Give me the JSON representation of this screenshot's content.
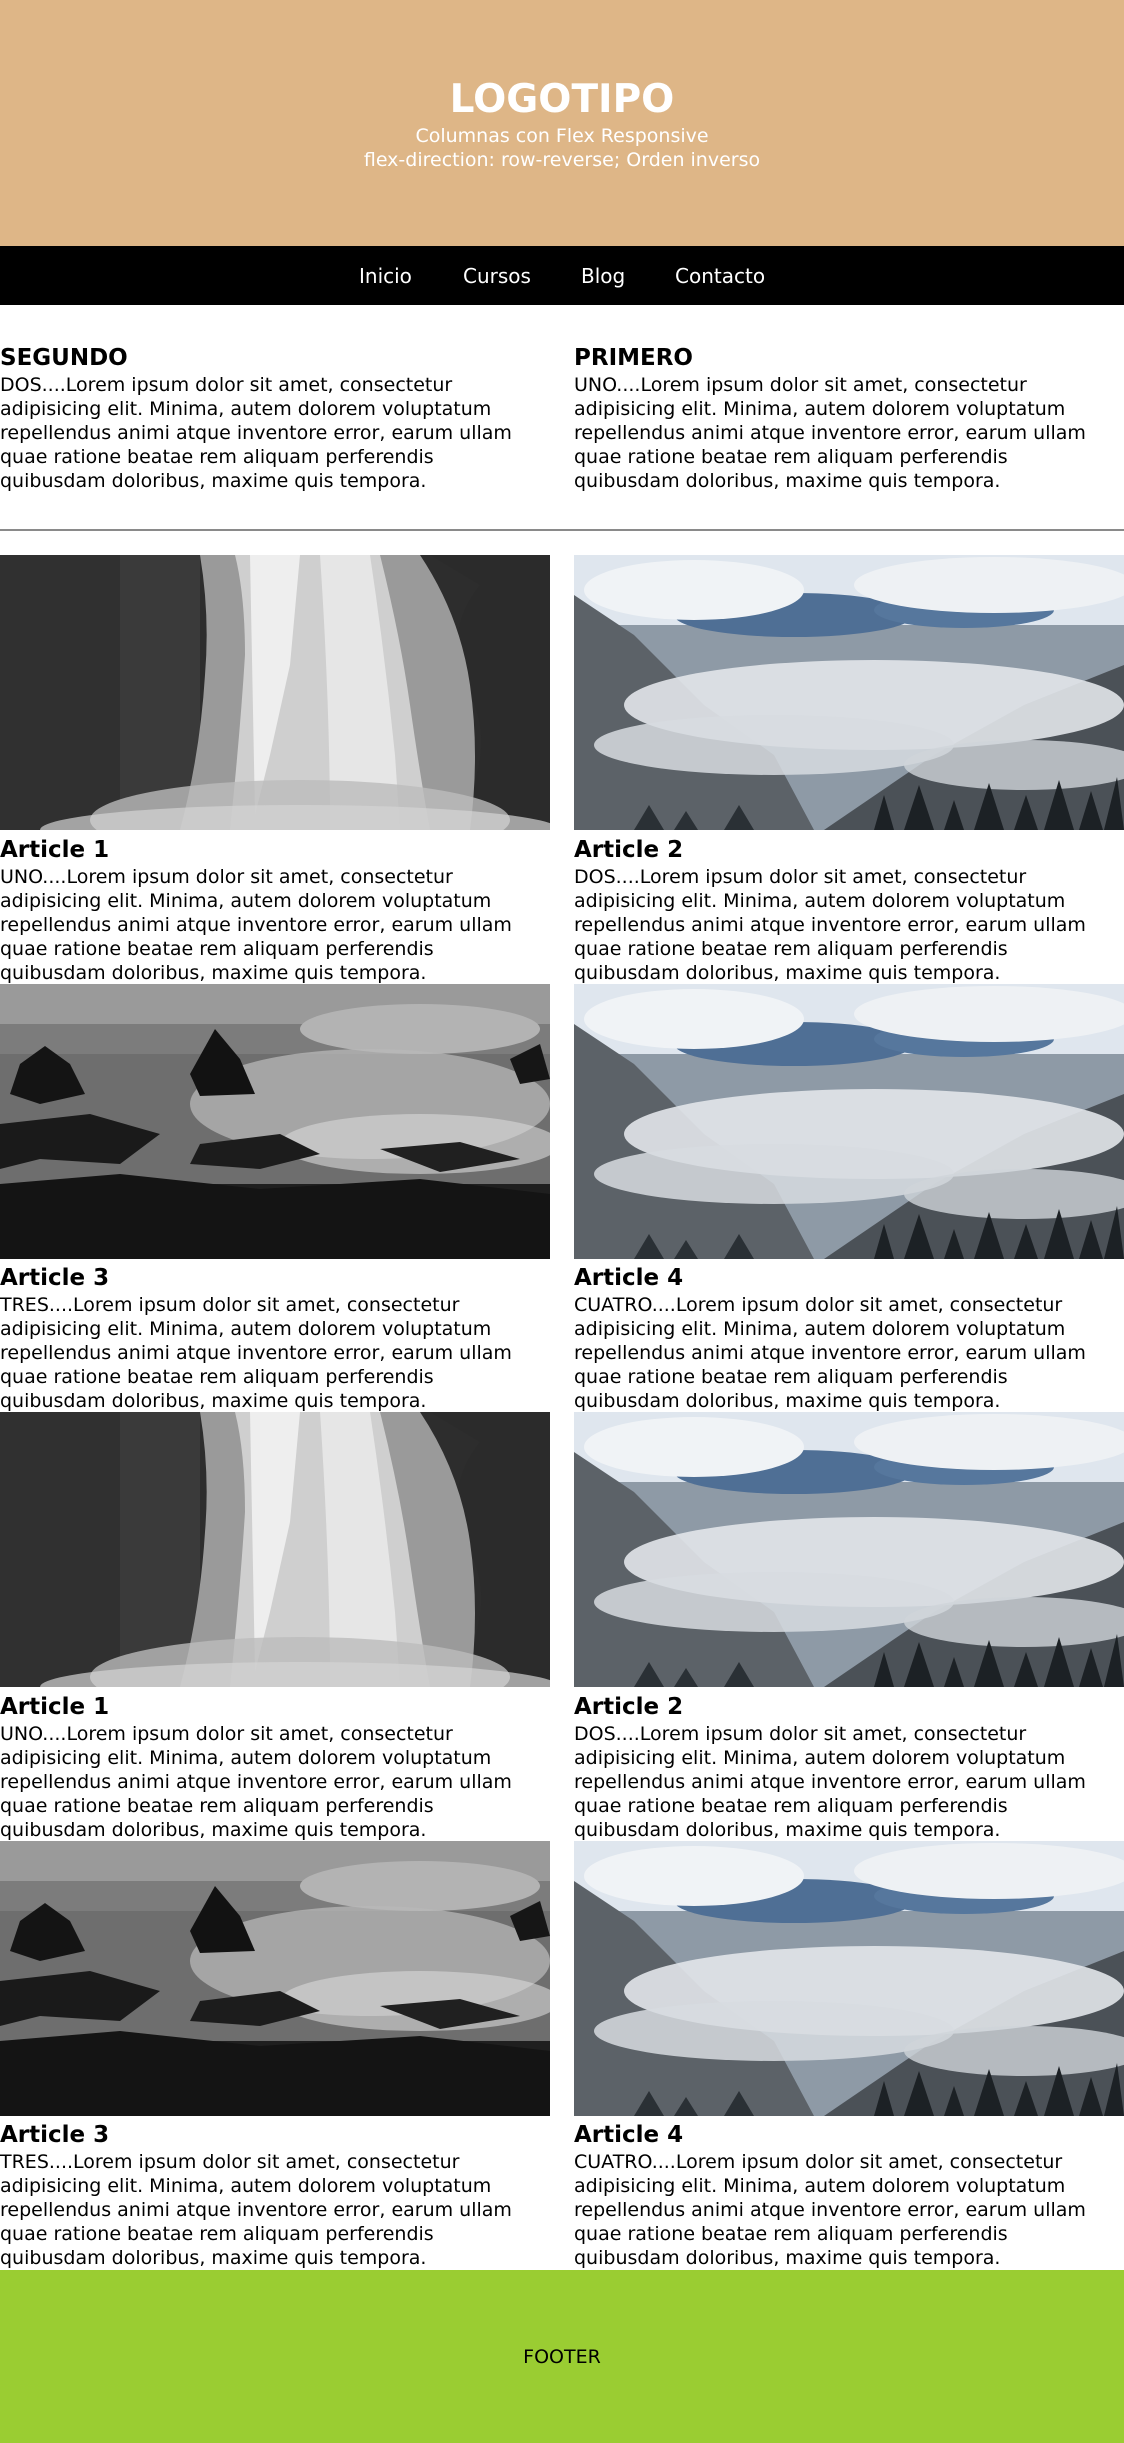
{
  "header": {
    "logo": "LOGOTIPO",
    "subtitle_line1": "Columnas con Flex Responsive",
    "subtitle_line2": "flex-direction: row-reverse; Orden inverso",
    "background_color": "#deb687"
  },
  "nav": {
    "items": [
      "Inicio",
      "Cursos",
      "Blog",
      "Contacto"
    ]
  },
  "intro": {
    "left": {
      "title": "SEGUNDO",
      "text": "DOS....Lorem ipsum dolor sit amet, consectetur adipisicing elit. Minima, autem dolorem voluptatum repellendus animi atque inventore error, earum ullam quae ratione beatae rem aliquam perferendis quibusdam doloribus, maxime quis tempora."
    },
    "right": {
      "title": "PRIMERO",
      "text": "UNO....Lorem ipsum dolor sit amet, consectetur adipisicing elit. Minima, autem dolorem voluptatum repellendus animi atque inventore error, earum ullam quae ratione beatae rem aliquam perferendis quibusdam doloribus, maxime quis tempora."
    }
  },
  "articles": [
    {
      "title": "Article 1",
      "image": "waterfall",
      "text": "UNO....Lorem ipsum dolor sit amet, consectetur adipisicing elit. Minima, autem dolorem voluptatum repellendus animi atque inventore error, earum ullam quae ratione beatae rem aliquam perferendis quibusdam doloribus, maxime quis tempora."
    },
    {
      "title": "Article 2",
      "image": "misty-mountains",
      "text": "DOS....Lorem ipsum dolor sit amet, consectetur adipisicing elit. Minima, autem dolorem voluptatum repellendus animi atque inventore error, earum ullam quae ratione beatae rem aliquam perferendis quibusdam doloribus, maxime quis tempora."
    },
    {
      "title": "Article 3",
      "image": "rocky-coast",
      "text": "TRES....Lorem ipsum dolor sit amet, consectetur adipisicing elit. Minima, autem dolorem voluptatum repellendus animi atque inventore error, earum ullam quae ratione beatae rem aliquam perferendis quibusdam doloribus, maxime quis tempora."
    },
    {
      "title": "Article 4",
      "image": "misty-mountains",
      "text": "CUATRO....Lorem ipsum dolor sit amet, consectetur adipisicing elit. Minima, autem dolorem voluptatum repellendus animi atque inventore error, earum ullam quae ratione beatae rem aliquam perferendis quibusdam doloribus, maxime quis tempora."
    },
    {
      "title": "Article 1",
      "image": "waterfall",
      "text": "UNO....Lorem ipsum dolor sit amet, consectetur adipisicing elit. Minima, autem dolorem voluptatum repellendus animi atque inventore error, earum ullam quae ratione beatae rem aliquam perferendis quibusdam doloribus, maxime quis tempora."
    },
    {
      "title": "Article 2",
      "image": "misty-mountains",
      "text": "DOS....Lorem ipsum dolor sit amet, consectetur adipisicing elit. Minima, autem dolorem voluptatum repellendus animi atque inventore error, earum ullam quae ratione beatae rem aliquam perferendis quibusdam doloribus, maxime quis tempora."
    },
    {
      "title": "Article 3",
      "image": "rocky-coast",
      "text": "TRES....Lorem ipsum dolor sit amet, consectetur adipisicing elit. Minima, autem dolorem voluptatum repellendus animi atque inventore error, earum ullam quae ratione beatae rem aliquam perferendis quibusdam doloribus, maxime quis tempora."
    },
    {
      "title": "Article 4",
      "image": "misty-mountains",
      "text": "CUATRO....Lorem ipsum dolor sit amet, consectetur adipisicing elit. Minima, autem dolorem voluptatum repellendus animi atque inventore error, earum ullam quae ratione beatae rem aliquam perferendis quibusdam doloribus, maxime quis tempora."
    }
  ],
  "footer": {
    "text": "FOOTER",
    "background_color": "#9acd32"
  }
}
